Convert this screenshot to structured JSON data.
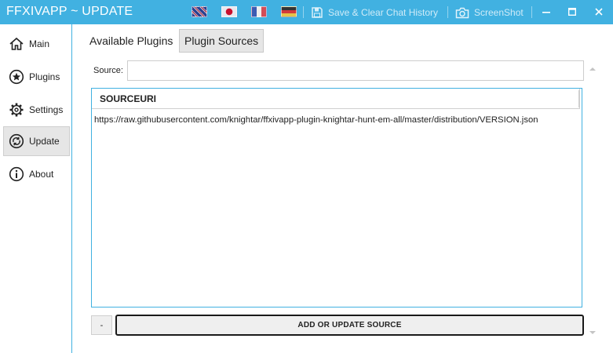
{
  "window": {
    "title": "FFXIVAPP ~ UPDATE",
    "save_clear_label": "Save & Clear Chat History",
    "screenshot_label": "ScreenShot",
    "flags": [
      "english-flag-icon",
      "japanese-flag-icon",
      "french-flag-icon",
      "german-flag-icon"
    ]
  },
  "sidebar": {
    "items": [
      {
        "label": "Main",
        "icon": "home-icon",
        "active": false
      },
      {
        "label": "Plugins",
        "icon": "star-icon",
        "active": false
      },
      {
        "label": "Settings",
        "icon": "gear-icon",
        "active": false
      },
      {
        "label": "Update",
        "icon": "update-icon",
        "active": true
      },
      {
        "label": "About",
        "icon": "info-icon",
        "active": false
      }
    ]
  },
  "tabs": {
    "available": "Available Plugins",
    "sources": "Plugin Sources",
    "selected": "Plugin Sources"
  },
  "source_field": {
    "label": "Source:",
    "value": "",
    "placeholder": ""
  },
  "grid": {
    "header": "SOURCEURI",
    "rows": [
      "https://raw.githubusercontent.com/knightar/ffxivapp-plugin-knightar-hunt-em-all/master/distribution/VERSION.json"
    ]
  },
  "actions": {
    "remove_label": "-",
    "add_label": "ADD OR UPDATE SOURCE"
  },
  "colors": {
    "accent": "#41b1e1",
    "active_bg": "#e6e6e6"
  }
}
